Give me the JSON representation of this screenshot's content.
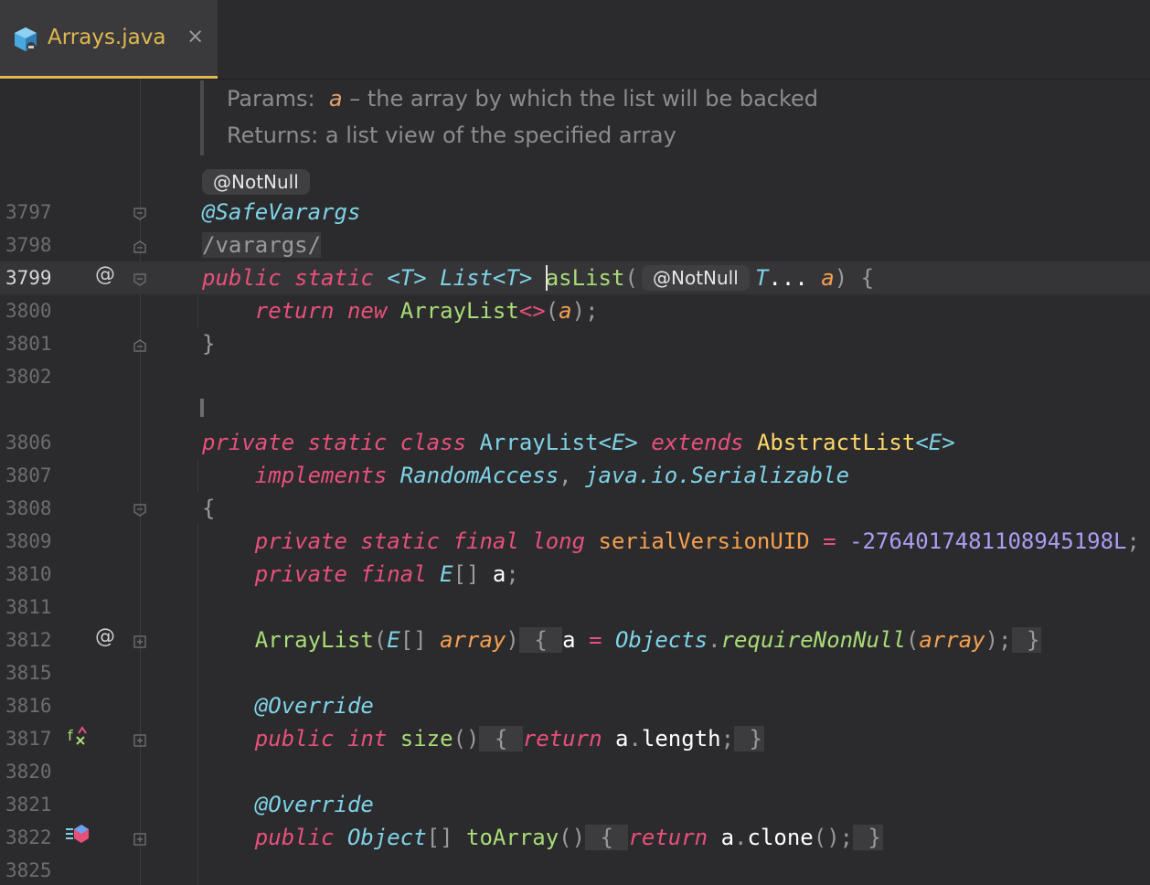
{
  "tab": {
    "title": "Arrays.java",
    "close": "×"
  },
  "doc": {
    "params_label": "Params:  ",
    "param_name": "a",
    "param_desc": " – the array by which the list will be backed",
    "returns": "Returns: a list view of the specified array"
  },
  "inlay_notnull": "@NotNull",
  "gutter": {
    "l3797": "3797",
    "l3798": "3798",
    "l3799": "3799",
    "l3800": "3800",
    "l3801": "3801",
    "l3802": "3802",
    "l3806": "3806",
    "l3807": "3807",
    "l3808": "3808",
    "l3809": "3809",
    "l3810": "3810",
    "l3811": "3811",
    "l3812": "3812",
    "l3815": "3815",
    "l3816": "3816",
    "l3817": "3817",
    "l3820": "3820",
    "l3821": "3821",
    "l3822": "3822",
    "l3825": "3825"
  },
  "icons": {
    "at": "@"
  },
  "code": {
    "safevarargs": "@SafeVarargs",
    "varargs_comment": "/varargs/",
    "public": "public",
    "static": "static",
    "private": "private",
    "final": "final",
    "class": "class",
    "extends": "extends",
    "implements": "implements",
    "return": "return",
    "new": "new",
    "long": "long",
    "int": "int",
    "T_gen": "<T>",
    "List": "List",
    "ListT": "<T>",
    "asList": "asList",
    "T": "T",
    "dots": "...",
    "a": "a",
    "ArrayList": "ArrayList",
    "diamond": "<>",
    "ArrayListE": "ArrayList",
    "E_gen": "<E>",
    "AbstractList": "AbstractList",
    "RandomAccess": "RandomAccess",
    "Serializable": "java.io.Serializable",
    "serialVersionUID": "serialVersionUID",
    "serialValue": "-2764017481108945198L",
    "E": "E",
    "array": "array",
    "Objects": "Objects",
    "requireNonNull": "requireNonNull",
    "Override": "@Override",
    "size": "size",
    "length": "length",
    "Object": "Object",
    "toArray": "toArray",
    "clone": "clone"
  }
}
